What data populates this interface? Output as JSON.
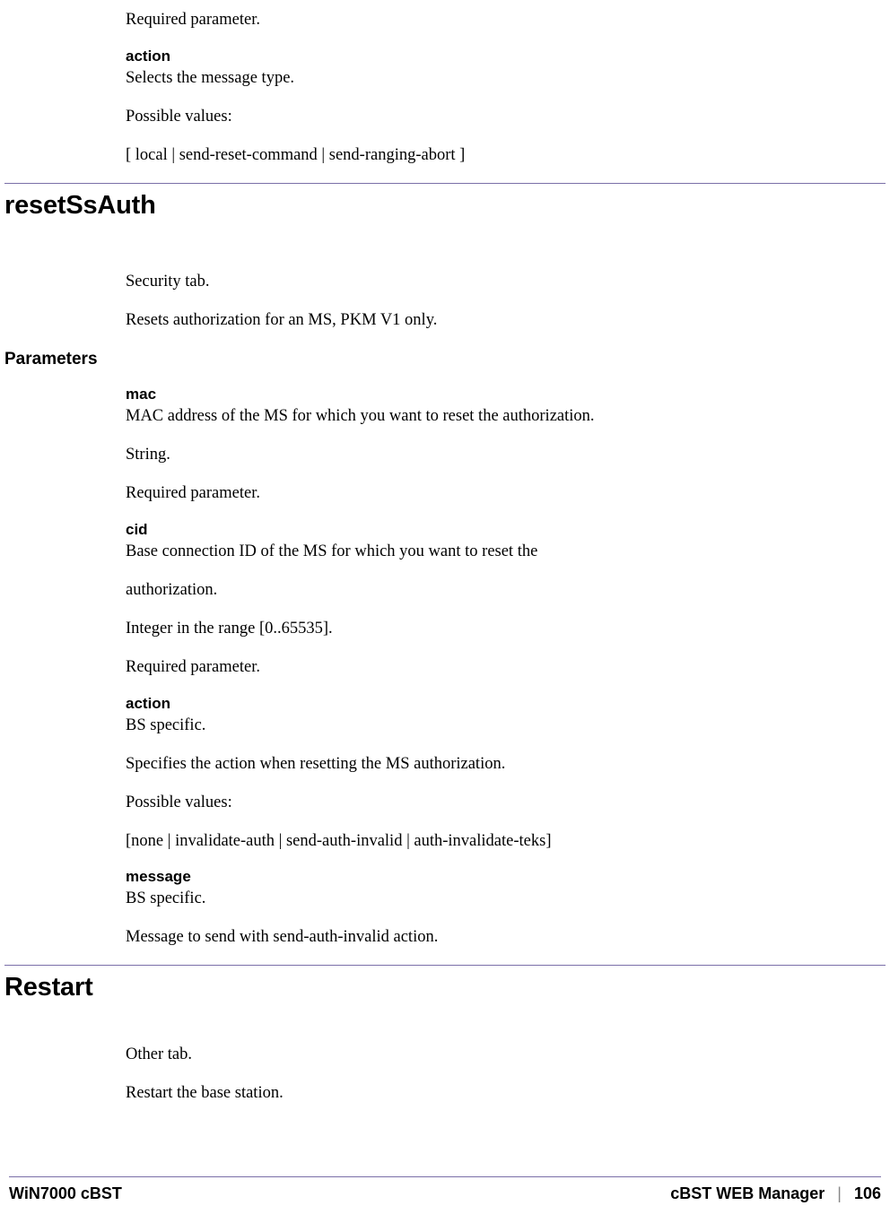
{
  "top": {
    "required": "Required parameter.",
    "action_label": "action",
    "action_desc": "Selects the message type.",
    "possible_values_label": "Possible values:",
    "possible_values": "[ local | send-reset-command | send-ranging-abort ]"
  },
  "section_resetSsAuth": {
    "title": "resetSsAuth",
    "tab": "Security tab.",
    "desc": "Resets authorization for an MS, PKM V1 only.",
    "parameters_heading": "Parameters",
    "mac": {
      "label": "mac",
      "desc": "MAC address of the MS for which you want to reset the authorization.",
      "type": "String.",
      "required": "Required parameter."
    },
    "cid": {
      "label": "cid",
      "desc1": "Base connection ID of the MS for which you want to reset the",
      "desc2": "authorization.",
      "type": "Integer in the range [0..65535].",
      "required": "Required parameter."
    },
    "action": {
      "label": "action",
      "bs": "BS specific.",
      "desc": "Specifies the action when resetting the MS authorization.",
      "possible_values_label": "Possible values:",
      "possible_values": "[none | invalidate-auth | send-auth-invalid | auth-invalidate-teks]"
    },
    "message": {
      "label": "message",
      "bs": "BS specific.",
      "desc": "Message to send with send-auth-invalid action."
    }
  },
  "section_restart": {
    "title": "Restart",
    "tab": "Other tab.",
    "desc": "Restart the base station."
  },
  "footer": {
    "left": "WiN7000 cBST",
    "right_label": "cBST WEB Manager",
    "separator": "|",
    "page_number": "106"
  }
}
